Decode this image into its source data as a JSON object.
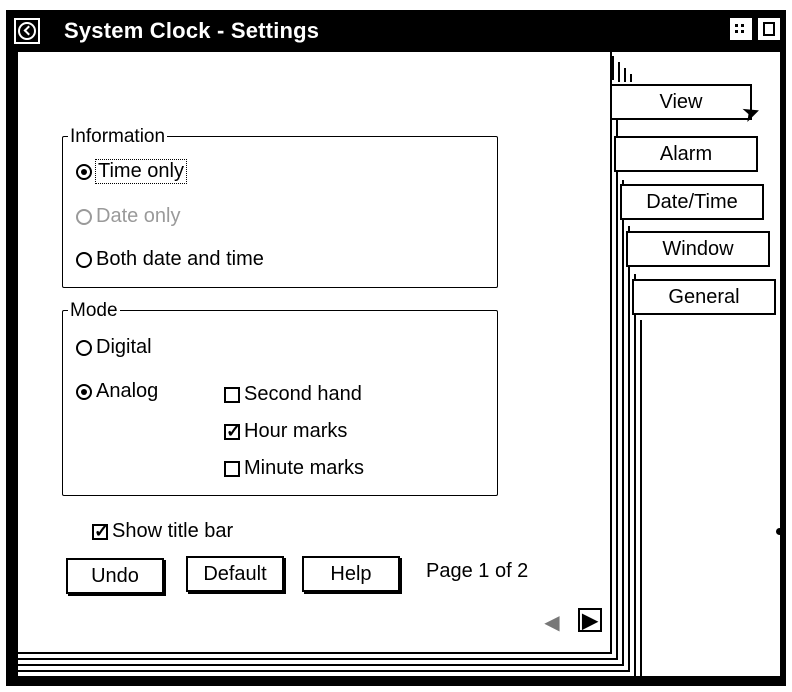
{
  "window": {
    "title": "System Clock - Settings"
  },
  "information_group": {
    "legend": "Information",
    "options": [
      {
        "label": "Time only",
        "selected": true,
        "enabled": true
      },
      {
        "label": "Date only",
        "selected": false,
        "enabled": false
      },
      {
        "label": "Both date and time",
        "selected": false,
        "enabled": true
      }
    ]
  },
  "mode_group": {
    "legend": "Mode",
    "options": [
      {
        "label": "Digital",
        "selected": false
      },
      {
        "label": "Analog",
        "selected": true
      }
    ],
    "checkboxes": [
      {
        "label": "Second hand",
        "checked": false
      },
      {
        "label": "Hour marks",
        "checked": true
      },
      {
        "label": "Minute marks",
        "checked": false
      }
    ]
  },
  "show_title_bar": {
    "label": "Show title bar",
    "checked": true
  },
  "buttons": {
    "undo": "Undo",
    "default": "Default",
    "help": "Help"
  },
  "page_info": "Page 1 of 2",
  "tabs": [
    {
      "label": "View",
      "active": true
    },
    {
      "label": "Alarm",
      "active": false
    },
    {
      "label": "Date/Time",
      "active": false
    },
    {
      "label": "Window",
      "active": false
    },
    {
      "label": "General",
      "active": false
    }
  ],
  "icons": {
    "system_menu": "system-menu-icon",
    "minimize": "minimize-icon",
    "maximize": "maximize-icon",
    "prev_page": "left-arrow-icon",
    "next_page": "right-arrow-icon",
    "cursor": "mouse-pointer-icon"
  }
}
